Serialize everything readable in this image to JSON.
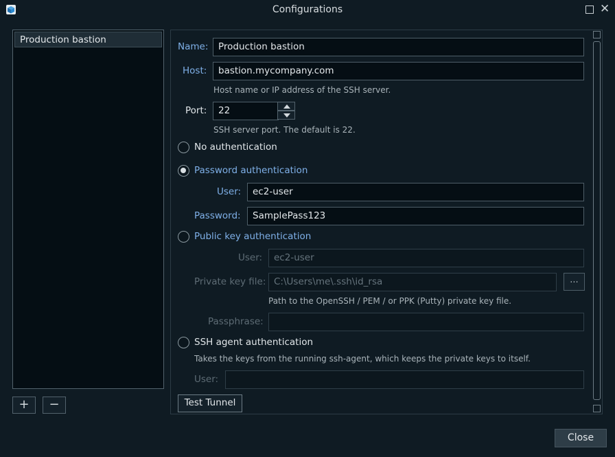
{
  "window": {
    "title": "Configurations",
    "icon": "app-cube-icon",
    "maximize_icon": "maximize-icon",
    "close_icon": "close-icon",
    "close_glyph": "✕"
  },
  "config_list": {
    "items": [
      {
        "label": "Production bastion"
      }
    ],
    "add_label": "+",
    "remove_label": "−"
  },
  "form": {
    "name": {
      "label": "Name:",
      "value": "Production bastion"
    },
    "host": {
      "label": "Host:",
      "value": "bastion.mycompany.com",
      "hint": "Host name or IP address of the SSH server."
    },
    "port": {
      "label": "Port:",
      "value": "22",
      "hint": "SSH server port. The default is 22."
    },
    "no_auth": {
      "label": "No authentication"
    },
    "password_auth": {
      "label": "Password authentication",
      "user_label": "User:",
      "user_value": "ec2-user",
      "password_label": "Password:",
      "password_value": "SamplePass123"
    },
    "pubkey_auth": {
      "label": "Public key authentication",
      "user_label": "User:",
      "user_placeholder": "ec2-user",
      "keyfile_label": "Private key file:",
      "keyfile_placeholder": "C:\\Users\\me\\.ssh\\id_rsa",
      "browse_label": "...",
      "keyfile_hint": "Path to the OpenSSH / PEM / or PPK (Putty) private key file.",
      "passphrase_label": "Passphrase:"
    },
    "agent_auth": {
      "label": "SSH agent authentication",
      "hint": "Takes the keys from the running ssh-agent, which keeps the private keys to itself.",
      "user_label": "User:"
    },
    "test_label": "Test Tunnel"
  },
  "footer": {
    "close_label": "Close"
  },
  "colors": {
    "accent_label": "#7fb0e8",
    "background": "#0f1b23",
    "field_background": "#050e14"
  }
}
